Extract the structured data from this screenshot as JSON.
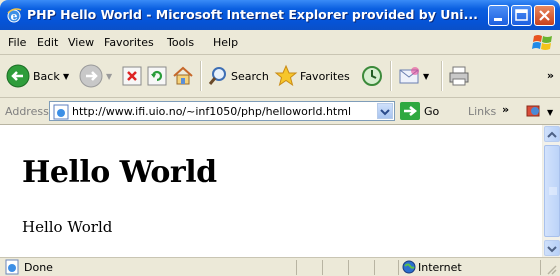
{
  "window": {
    "title": "PHP Hello World - Microsoft Internet Explorer provided by Uni...",
    "title_icon": "ie-icon"
  },
  "menu": {
    "items": [
      {
        "label": "File"
      },
      {
        "label": "Edit"
      },
      {
        "label": "View"
      },
      {
        "label": "Favorites"
      },
      {
        "label": "Tools"
      },
      {
        "label": "Help"
      }
    ]
  },
  "toolbar": {
    "back_label": "Back",
    "search_label": "Search",
    "favorites_label": "Favorites",
    "more_chevron": "»"
  },
  "address": {
    "label": "Address",
    "url": "http://www.ifi.uio.no/~inf1050/php/helloworld.html",
    "go_label": "Go",
    "links_label": "Links",
    "links_chevron": "»"
  },
  "page": {
    "heading": "Hello World",
    "paragraph": "Hello World"
  },
  "status": {
    "text": "Done",
    "zone": "Internet"
  },
  "colors": {
    "titlebar": "#0554d8",
    "chrome": "#ece9d8",
    "accent_green": "#2fa840"
  }
}
